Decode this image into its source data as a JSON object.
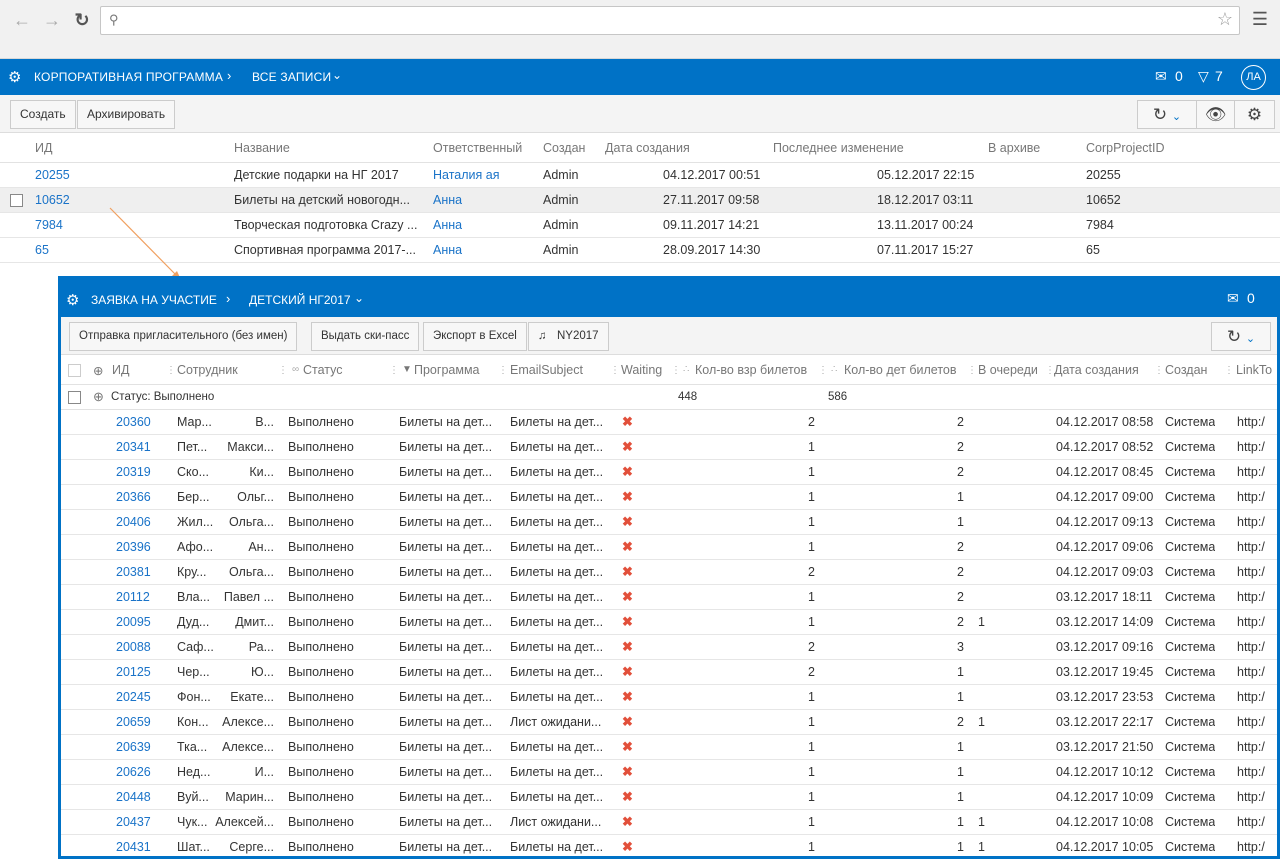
{
  "browser": {
    "url": ""
  },
  "topbar": {
    "crumb1": "КОРПОРАТИВНАЯ ПРОГРАММА",
    "crumb2": "ВСЕ ЗАПИСИ",
    "mail_count": "0",
    "filter_count": "7",
    "avatar": "ЛА"
  },
  "toolbar": {
    "create": "Создать",
    "archive": "Архивировать"
  },
  "table1": {
    "headers": [
      "ИД",
      "Название",
      "Ответственный",
      "Создан",
      "Дата создания",
      "Последнее изменение",
      "В архиве",
      "CorpProjectID"
    ],
    "rows": [
      [
        "20255",
        "Детские подарки на НГ 2017",
        "Наталия ая",
        "Admin",
        "04.12.2017 00:51",
        "05.12.2017 22:15",
        "",
        "20255"
      ],
      [
        "10652",
        "Билеты на детский новогодн...",
        "Анна",
        "Admin",
        "27.11.2017 09:58",
        "18.12.2017 03:11",
        "",
        "10652"
      ],
      [
        "7984",
        "Творческая подготовка Crazy ...",
        "Анна",
        "Admin",
        "09.11.2017 14:21",
        "13.11.2017 00:24",
        "",
        "7984"
      ],
      [
        "65",
        "Спортивная программа 2017-...",
        "Анна",
        "Admin",
        "28.09.2017 14:30",
        "07.11.2017 15:27",
        "",
        "65"
      ]
    ]
  },
  "panel": {
    "crumb1": "ЗАЯВКА НА УЧАСТИЕ",
    "crumb2": "ДЕТСКИЙ НГ2017",
    "mail_count": "0",
    "buttons": [
      "Отправка пригласительного (без имен)",
      "Выдать ски-пасс",
      "Экспорт в Excel",
      "NY2017"
    ],
    "headers": [
      "ИД",
      "Сотрудник",
      "Статус",
      "Программа",
      "EmailSubject",
      "Waiting",
      "Кол-во взр билетов",
      "Кол-во дет билетов",
      "В очереди",
      "Дата создания",
      "Создан",
      "LinkTo"
    ],
    "group_label": "Статус: Выполнено",
    "group_adult_sum": "448",
    "group_child_sum": "586",
    "rows": [
      [
        "20360",
        "Мар...",
        "В...",
        "Выполнено",
        "Билеты на дет...",
        "Билеты на дет...",
        "2",
        "2",
        "",
        "04.12.2017 08:58",
        "Система",
        "http:/"
      ],
      [
        "20341",
        "Пет...",
        "Макси...",
        "Выполнено",
        "Билеты на дет...",
        "Билеты на дет...",
        "1",
        "2",
        "",
        "04.12.2017 08:52",
        "Система",
        "http:/"
      ],
      [
        "20319",
        "Ско...",
        "Ки...",
        "Выполнено",
        "Билеты на дет...",
        "Билеты на дет...",
        "1",
        "2",
        "",
        "04.12.2017 08:45",
        "Система",
        "http:/"
      ],
      [
        "20366",
        "Бер...",
        "Ольг...",
        "Выполнено",
        "Билеты на дет...",
        "Билеты на дет...",
        "1",
        "1",
        "",
        "04.12.2017 09:00",
        "Система",
        "http:/"
      ],
      [
        "20406",
        "Жил...",
        "Ольга...",
        "Выполнено",
        "Билеты на дет...",
        "Билеты на дет...",
        "1",
        "1",
        "",
        "04.12.2017 09:13",
        "Система",
        "http:/"
      ],
      [
        "20396",
        "Афо...",
        "Ан...",
        "Выполнено",
        "Билеты на дет...",
        "Билеты на дет...",
        "1",
        "2",
        "",
        "04.12.2017 09:06",
        "Система",
        "http:/"
      ],
      [
        "20381",
        "Кру...",
        "Ольга...",
        "Выполнено",
        "Билеты на дет...",
        "Билеты на дет...",
        "2",
        "2",
        "",
        "04.12.2017 09:03",
        "Система",
        "http:/"
      ],
      [
        "20112",
        "Вла...",
        "Павел ...",
        "Выполнено",
        "Билеты на дет...",
        "Билеты на дет...",
        "1",
        "2",
        "",
        "03.12.2017 18:11",
        "Система",
        "http:/"
      ],
      [
        "20095",
        "Дуд...",
        "Дмит...",
        "Выполнено",
        "Билеты на дет...",
        "Билеты на дет...",
        "1",
        "2",
        "1",
        "03.12.2017 14:09",
        "Система",
        "http:/"
      ],
      [
        "20088",
        "Саф...",
        "Ра...",
        "Выполнено",
        "Билеты на дет...",
        "Билеты на дет...",
        "2",
        "3",
        "",
        "03.12.2017 09:16",
        "Система",
        "http:/"
      ],
      [
        "20125",
        "Чер...",
        "Ю...",
        "Выполнено",
        "Билеты на дет...",
        "Билеты на дет...",
        "2",
        "1",
        "",
        "03.12.2017 19:45",
        "Система",
        "http:/"
      ],
      [
        "20245",
        "Фон...",
        "Екате...",
        "Выполнено",
        "Билеты на дет...",
        "Билеты на дет...",
        "1",
        "1",
        "",
        "03.12.2017 23:53",
        "Система",
        "http:/"
      ],
      [
        "20659",
        "Кон...",
        "Алексе...",
        "Выполнено",
        "Билеты на дет...",
        "Лист ожидани...",
        "1",
        "2",
        "1",
        "03.12.2017 22:17",
        "Система",
        "http:/"
      ],
      [
        "20639",
        "Тка...",
        "Алексе...",
        "Выполнено",
        "Билеты на дет...",
        "Билеты на дет...",
        "1",
        "1",
        "",
        "03.12.2017 21:50",
        "Система",
        "http:/"
      ],
      [
        "20626",
        "Нед...",
        "И...",
        "Выполнено",
        "Билеты на дет...",
        "Билеты на дет...",
        "1",
        "1",
        "",
        "04.12.2017 10:12",
        "Система",
        "http:/"
      ],
      [
        "20448",
        "Вуй...",
        "Марин...",
        "Выполнено",
        "Билеты на дет...",
        "Билеты на дет...",
        "1",
        "1",
        "",
        "04.12.2017 10:09",
        "Система",
        "http:/"
      ],
      [
        "20437",
        "Чук...",
        "Алексей...",
        "Выполнено",
        "Билеты на дет...",
        "Лист ожидани...",
        "1",
        "1",
        "1",
        "04.12.2017 10:08",
        "Система",
        "http:/"
      ],
      [
        "20431",
        "Шат...",
        "Серге...",
        "Выполнено",
        "Билеты на дет...",
        "Билеты на дет...",
        "1",
        "1",
        "1",
        "04.12.2017 10:05",
        "Система",
        "http:/"
      ]
    ]
  },
  "colors": {
    "brand": "#0072c6",
    "link": "#1a73c8",
    "cross": "#e2503b",
    "arrow": "#f0a060"
  }
}
